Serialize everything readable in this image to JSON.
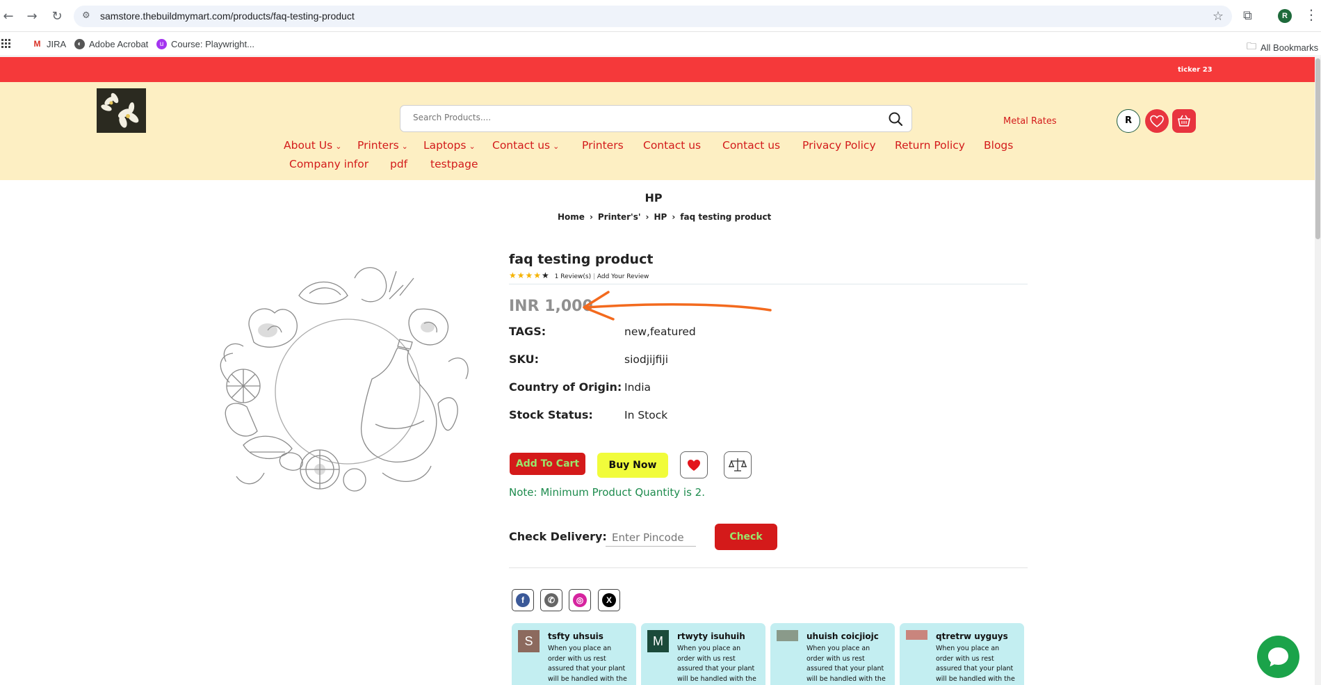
{
  "browser": {
    "url": "samstore.thebuildmymart.com/products/faq-testing-product",
    "bookmarks": [
      {
        "label": "JIRA"
      },
      {
        "label": "Adobe Acrobat"
      },
      {
        "label": "Course: Playwright..."
      }
    ],
    "all_bookmarks": "All Bookmarks",
    "profile_initial": "R"
  },
  "site": {
    "ticker": "ticker 23",
    "search_placeholder": "Search Products....",
    "metal_rates": "Metal Rates",
    "user_initial": "R",
    "nav": [
      {
        "label": "About Us",
        "dropdown": true
      },
      {
        "label": "Printers",
        "dropdown": true
      },
      {
        "label": "Laptops",
        "dropdown": true
      },
      {
        "label": "Contact us",
        "dropdown": true
      },
      {
        "label": "Printers",
        "dropdown": false
      },
      {
        "label": "Contact us",
        "dropdown": false
      },
      {
        "label": "Contact us",
        "dropdown": false
      },
      {
        "label": "Privacy Policy",
        "dropdown": false
      },
      {
        "label": "Return Policy",
        "dropdown": false
      },
      {
        "label": "Blogs",
        "dropdown": false
      },
      {
        "label": "Company infor",
        "dropdown": false
      },
      {
        "label": "pdf",
        "dropdown": false
      },
      {
        "label": "testpage",
        "dropdown": false
      }
    ],
    "colors": {
      "ticker": "#f5393a",
      "header": "#fdefc3",
      "accent": "#d31b1b"
    }
  },
  "page": {
    "heading": "HP",
    "breadcrumb": [
      "Home",
      "Printer's'",
      "HP",
      "faq testing product"
    ]
  },
  "product": {
    "title": "faq testing product",
    "rating": 4,
    "rating_max": 5,
    "reviews": "1 Review(s)",
    "add_review": "Add Your Review",
    "price": "INR 1,000",
    "attributes": [
      {
        "label": "TAGS:",
        "value": "new,featured"
      },
      {
        "label": "SKU:",
        "value": "siodjijfiji"
      },
      {
        "label": "Country of Origin:",
        "value": "India"
      },
      {
        "label": "Stock Status:",
        "value": "In Stock"
      }
    ],
    "add_to_cart": "Add To Cart",
    "buy_now": "Buy Now",
    "note": "Note: Minimum Product Quantity is 2.",
    "check_delivery": "Check Delivery:",
    "pincode_placeholder": "Enter Pincode",
    "check": "Check"
  },
  "social": [
    "facebook-icon",
    "whatsapp-icon",
    "instagram-icon",
    "x-icon"
  ],
  "reviews": [
    {
      "name": "tsfty uhsuis",
      "initial": "S",
      "text": "When you place an order with us rest assured that your plant will be handled with the almost careful."
    },
    {
      "name": "rtwyty isuhuih",
      "initial": "M",
      "text": "When you place an order with us rest assured that your plant will be handled with the almost careful."
    },
    {
      "name": "uhuish coicjiojc",
      "initial": "",
      "text": "When you place an order with us rest assured that your plant will be handled with the almost careful."
    },
    {
      "name": "qtretrw uyguys",
      "initial": "",
      "text": "When you place an order with us rest assured that your plant will be handled with the almost careful."
    }
  ]
}
